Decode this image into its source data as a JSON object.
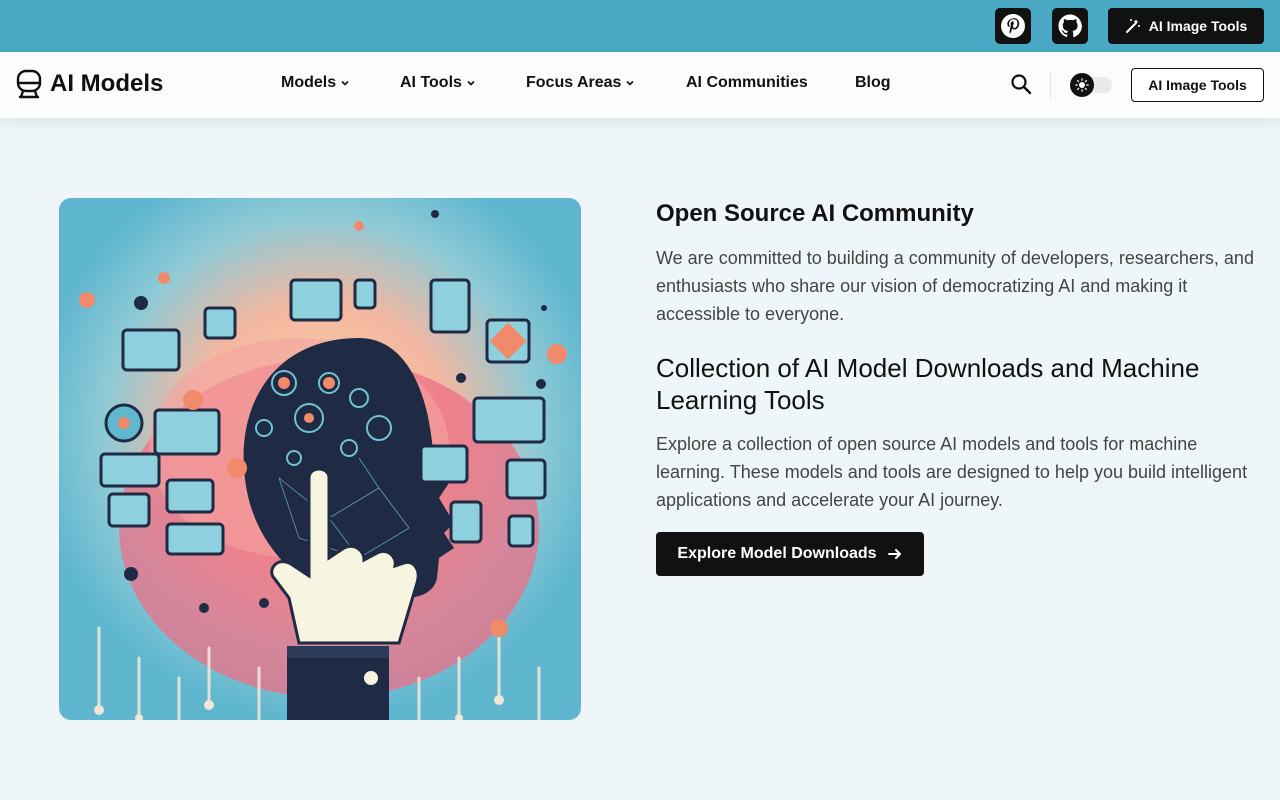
{
  "topbar": {
    "icons": [
      "pinterest-icon",
      "github-icon"
    ],
    "button_label": "AI Image Tools"
  },
  "nav": {
    "logo_text": "AI Models",
    "items": [
      {
        "label": "Models",
        "dropdown": true
      },
      {
        "label": "AI Tools",
        "dropdown": true
      },
      {
        "label": "Focus Areas",
        "dropdown": true
      },
      {
        "label": "AI Communities",
        "dropdown": false
      },
      {
        "label": "Blog",
        "dropdown": false
      }
    ],
    "button_label": "AI Image Tools"
  },
  "hero": {
    "section1_title": "Open Source AI Community",
    "section1_text": "We are committed to building a community of developers, researchers, and enthusiasts who share our vision of democratizing AI and making it accessible to everyone.",
    "section2_title": "Collection of AI Model Downloads and Machine Learning Tools",
    "section2_text": "Explore a collection of open source AI models and tools for machine learning. These models and tools are designed to help you build intelligent applications and accelerate your AI journey.",
    "cta_label": "Explore Model Downloads"
  },
  "colors": {
    "topbar": "#4aaac6",
    "background": "#eff6f9",
    "dark": "#111111"
  }
}
